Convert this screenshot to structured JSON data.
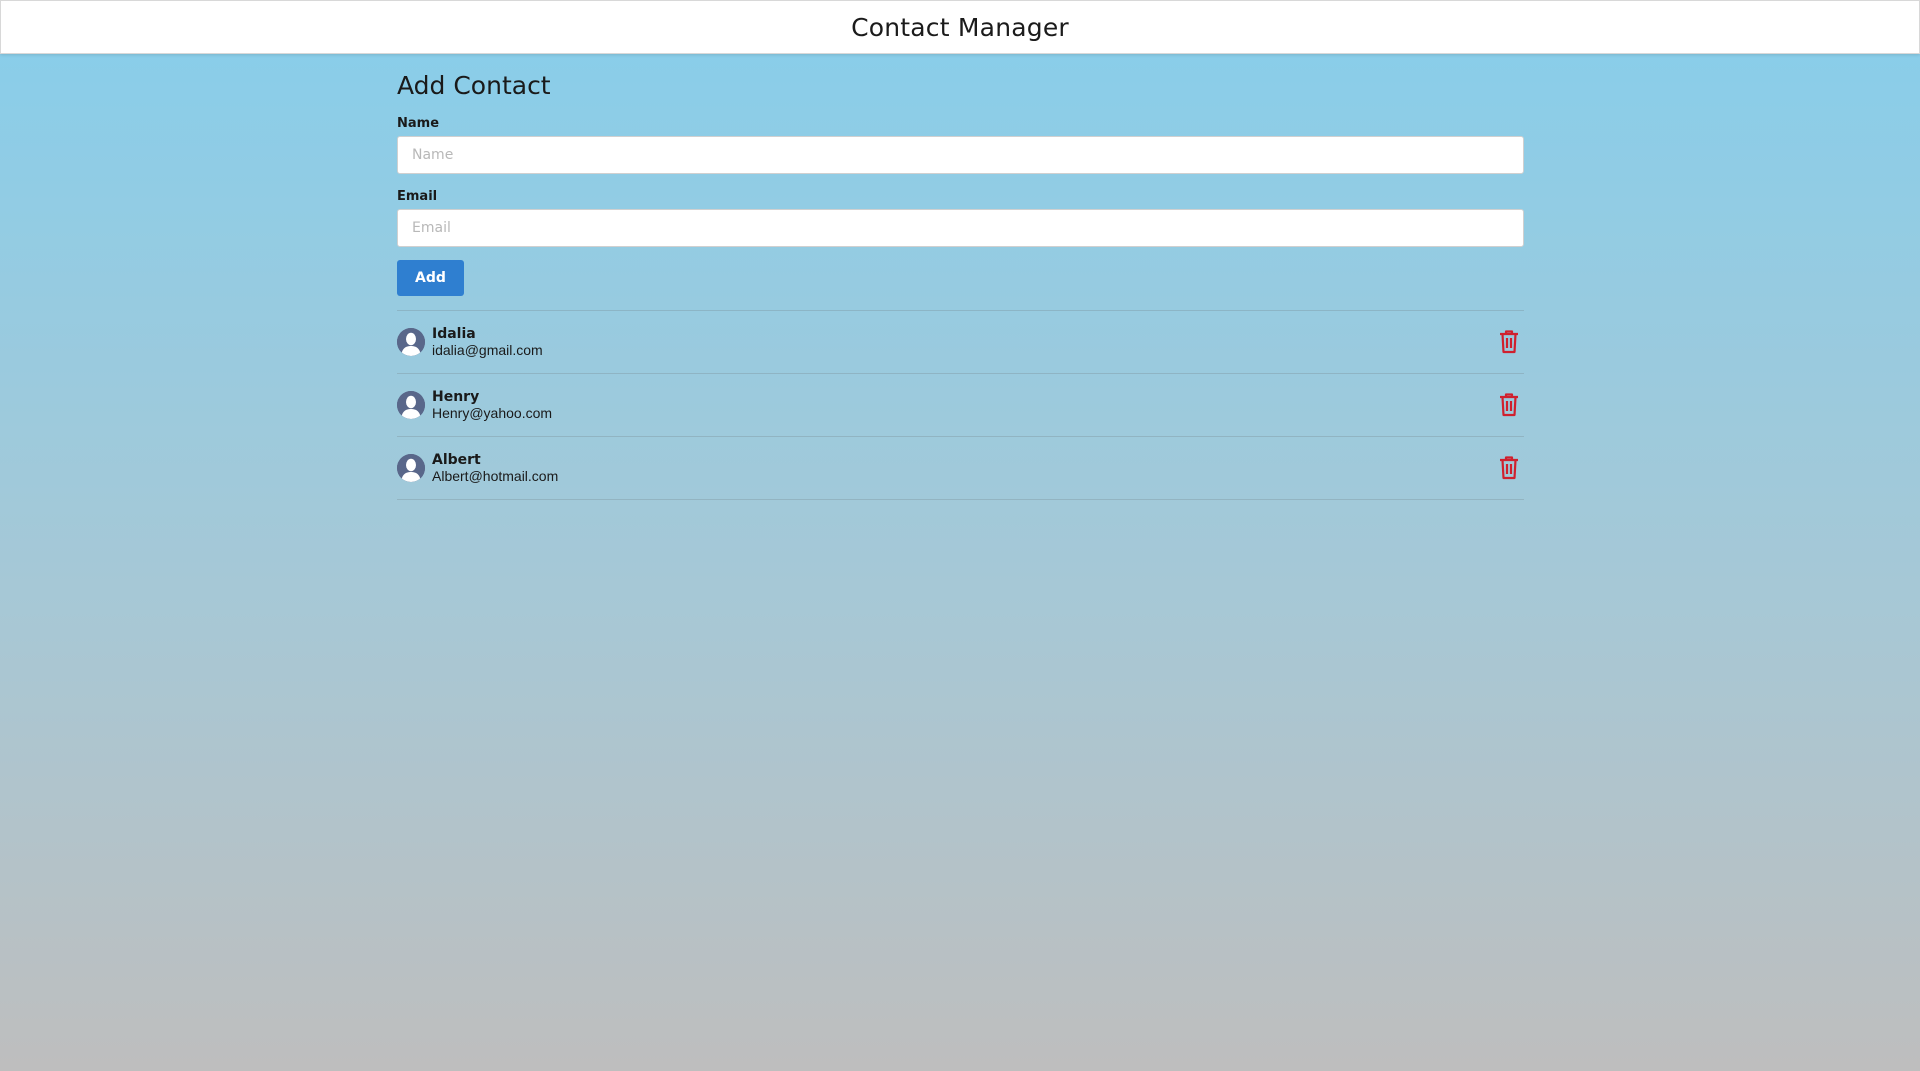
{
  "header": {
    "title": "Contact Manager"
  },
  "form": {
    "title": "Add Contact",
    "name_label": "Name",
    "name_placeholder": "Name",
    "email_label": "Email",
    "email_placeholder": "Email",
    "add_label": "Add"
  },
  "contacts": [
    {
      "name": "Idalia",
      "email": "idalia@gmail.com",
      "avatar_icon": "user-avatar-icon",
      "delete_icon": "trash-icon"
    },
    {
      "name": "Henry",
      "email": "Henry@yahoo.com",
      "avatar_icon": "user-avatar-icon",
      "delete_icon": "trash-icon"
    },
    {
      "name": "Albert",
      "email": "Albert@hotmail.com",
      "avatar_icon": "user-avatar-icon",
      "delete_icon": "trash-icon"
    }
  ],
  "colors": {
    "accent": "#2f7fd0",
    "delete": "#d0202e",
    "avatar": "#59678a"
  }
}
